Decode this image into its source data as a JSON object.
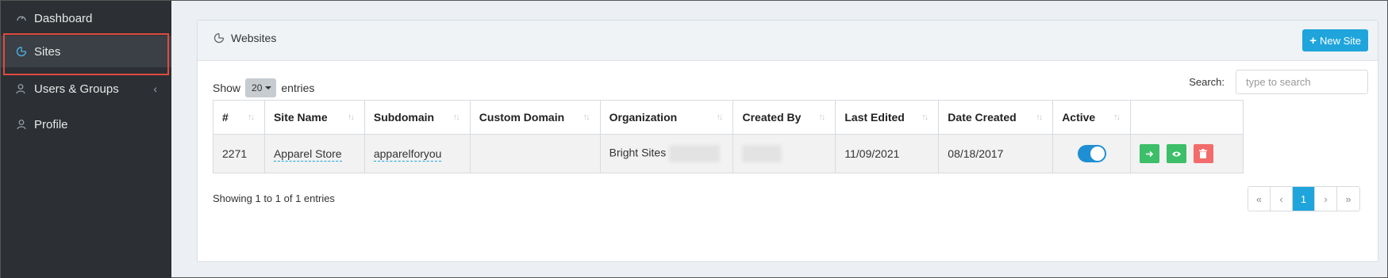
{
  "sidebar": {
    "items": [
      {
        "label": "Dashboard",
        "icon": "dashboard-icon"
      },
      {
        "label": "Sites",
        "icon": "sites-icon",
        "active": true
      },
      {
        "label": "Users & Groups",
        "icon": "users-icon",
        "chevron": "‹"
      },
      {
        "label": "Profile",
        "icon": "profile-icon"
      }
    ]
  },
  "panel": {
    "title": "Websites",
    "new_button": "New Site",
    "new_button_icon": "+"
  },
  "controls": {
    "show_label": "Show",
    "page_length": "20",
    "entries_label": "entries",
    "search_label": "Search:",
    "search_placeholder": "type to search"
  },
  "table": {
    "columns": [
      "#",
      "Site Name",
      "Subdomain",
      "Custom Domain",
      "Organization",
      "Created By",
      "Last Edited",
      "Date Created",
      "Active",
      ""
    ],
    "sort_glyph": "↑↓",
    "rows": [
      {
        "id": "2271",
        "site_name": "Apparel Store",
        "subdomain": "apparelforyou",
        "custom_domain": "",
        "organization": "Bright Sites",
        "created_by": "",
        "last_edited": "11/09/2021",
        "date_created": "08/18/2017",
        "active": true
      }
    ]
  },
  "footer": {
    "info": "Showing 1 to 1 of 1 entries",
    "pager": [
      "«",
      "‹",
      "1",
      "›",
      "»"
    ],
    "current_page": "1"
  },
  "colors": {
    "accent": "#1fa5dc",
    "sidebar_bg": "#2c3034",
    "highlight": "#e04a3f",
    "green": "#3cbf68",
    "red": "#f26c6c"
  }
}
